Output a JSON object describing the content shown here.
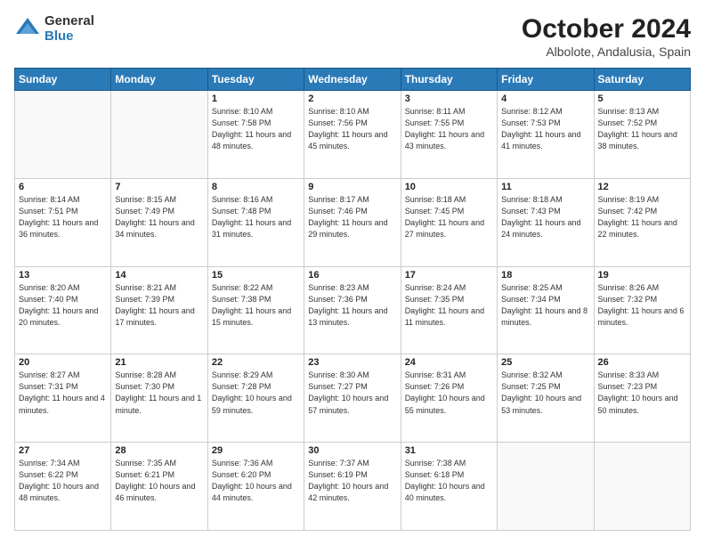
{
  "logo": {
    "general": "General",
    "blue": "Blue"
  },
  "title": {
    "month": "October 2024",
    "location": "Albolote, Andalusia, Spain"
  },
  "headers": [
    "Sunday",
    "Monday",
    "Tuesday",
    "Wednesday",
    "Thursday",
    "Friday",
    "Saturday"
  ],
  "weeks": [
    [
      {
        "day": "",
        "info": ""
      },
      {
        "day": "",
        "info": ""
      },
      {
        "day": "1",
        "info": "Sunrise: 8:10 AM\nSunset: 7:58 PM\nDaylight: 11 hours and 48 minutes."
      },
      {
        "day": "2",
        "info": "Sunrise: 8:10 AM\nSunset: 7:56 PM\nDaylight: 11 hours and 45 minutes."
      },
      {
        "day": "3",
        "info": "Sunrise: 8:11 AM\nSunset: 7:55 PM\nDaylight: 11 hours and 43 minutes."
      },
      {
        "day": "4",
        "info": "Sunrise: 8:12 AM\nSunset: 7:53 PM\nDaylight: 11 hours and 41 minutes."
      },
      {
        "day": "5",
        "info": "Sunrise: 8:13 AM\nSunset: 7:52 PM\nDaylight: 11 hours and 38 minutes."
      }
    ],
    [
      {
        "day": "6",
        "info": "Sunrise: 8:14 AM\nSunset: 7:51 PM\nDaylight: 11 hours and 36 minutes."
      },
      {
        "day": "7",
        "info": "Sunrise: 8:15 AM\nSunset: 7:49 PM\nDaylight: 11 hours and 34 minutes."
      },
      {
        "day": "8",
        "info": "Sunrise: 8:16 AM\nSunset: 7:48 PM\nDaylight: 11 hours and 31 minutes."
      },
      {
        "day": "9",
        "info": "Sunrise: 8:17 AM\nSunset: 7:46 PM\nDaylight: 11 hours and 29 minutes."
      },
      {
        "day": "10",
        "info": "Sunrise: 8:18 AM\nSunset: 7:45 PM\nDaylight: 11 hours and 27 minutes."
      },
      {
        "day": "11",
        "info": "Sunrise: 8:18 AM\nSunset: 7:43 PM\nDaylight: 11 hours and 24 minutes."
      },
      {
        "day": "12",
        "info": "Sunrise: 8:19 AM\nSunset: 7:42 PM\nDaylight: 11 hours and 22 minutes."
      }
    ],
    [
      {
        "day": "13",
        "info": "Sunrise: 8:20 AM\nSunset: 7:40 PM\nDaylight: 11 hours and 20 minutes."
      },
      {
        "day": "14",
        "info": "Sunrise: 8:21 AM\nSunset: 7:39 PM\nDaylight: 11 hours and 17 minutes."
      },
      {
        "day": "15",
        "info": "Sunrise: 8:22 AM\nSunset: 7:38 PM\nDaylight: 11 hours and 15 minutes."
      },
      {
        "day": "16",
        "info": "Sunrise: 8:23 AM\nSunset: 7:36 PM\nDaylight: 11 hours and 13 minutes."
      },
      {
        "day": "17",
        "info": "Sunrise: 8:24 AM\nSunset: 7:35 PM\nDaylight: 11 hours and 11 minutes."
      },
      {
        "day": "18",
        "info": "Sunrise: 8:25 AM\nSunset: 7:34 PM\nDaylight: 11 hours and 8 minutes."
      },
      {
        "day": "19",
        "info": "Sunrise: 8:26 AM\nSunset: 7:32 PM\nDaylight: 11 hours and 6 minutes."
      }
    ],
    [
      {
        "day": "20",
        "info": "Sunrise: 8:27 AM\nSunset: 7:31 PM\nDaylight: 11 hours and 4 minutes."
      },
      {
        "day": "21",
        "info": "Sunrise: 8:28 AM\nSunset: 7:30 PM\nDaylight: 11 hours and 1 minute."
      },
      {
        "day": "22",
        "info": "Sunrise: 8:29 AM\nSunset: 7:28 PM\nDaylight: 10 hours and 59 minutes."
      },
      {
        "day": "23",
        "info": "Sunrise: 8:30 AM\nSunset: 7:27 PM\nDaylight: 10 hours and 57 minutes."
      },
      {
        "day": "24",
        "info": "Sunrise: 8:31 AM\nSunset: 7:26 PM\nDaylight: 10 hours and 55 minutes."
      },
      {
        "day": "25",
        "info": "Sunrise: 8:32 AM\nSunset: 7:25 PM\nDaylight: 10 hours and 53 minutes."
      },
      {
        "day": "26",
        "info": "Sunrise: 8:33 AM\nSunset: 7:23 PM\nDaylight: 10 hours and 50 minutes."
      }
    ],
    [
      {
        "day": "27",
        "info": "Sunrise: 7:34 AM\nSunset: 6:22 PM\nDaylight: 10 hours and 48 minutes."
      },
      {
        "day": "28",
        "info": "Sunrise: 7:35 AM\nSunset: 6:21 PM\nDaylight: 10 hours and 46 minutes."
      },
      {
        "day": "29",
        "info": "Sunrise: 7:36 AM\nSunset: 6:20 PM\nDaylight: 10 hours and 44 minutes."
      },
      {
        "day": "30",
        "info": "Sunrise: 7:37 AM\nSunset: 6:19 PM\nDaylight: 10 hours and 42 minutes."
      },
      {
        "day": "31",
        "info": "Sunrise: 7:38 AM\nSunset: 6:18 PM\nDaylight: 10 hours and 40 minutes."
      },
      {
        "day": "",
        "info": ""
      },
      {
        "day": "",
        "info": ""
      }
    ]
  ]
}
